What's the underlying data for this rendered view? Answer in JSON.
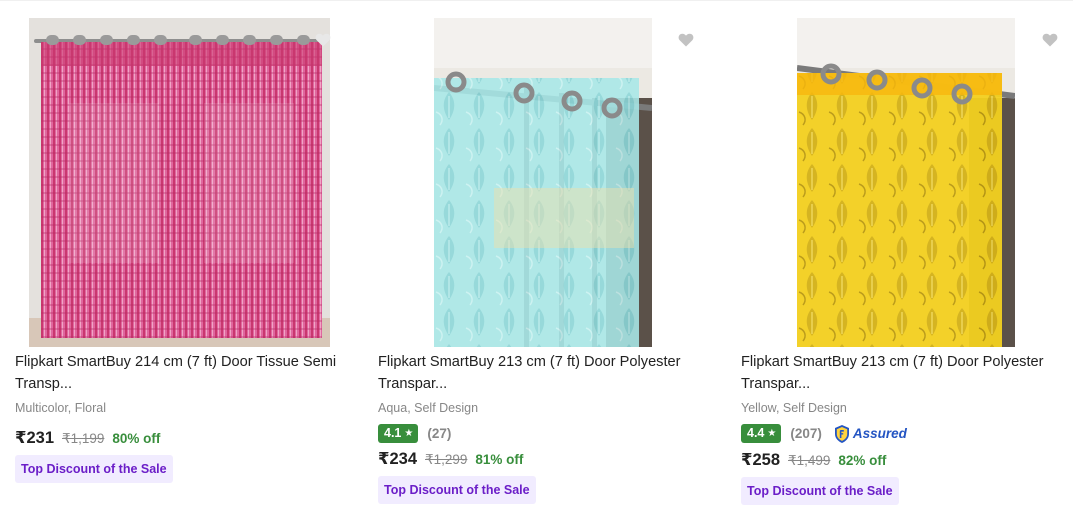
{
  "products": [
    {
      "title": "Flipkart SmartBuy 214 cm (7 ft) Door Tissue Semi",
      "title2": "Transp...",
      "variant": "Multicolor, Floral",
      "price": "₹231",
      "mrp": "₹1,199",
      "discount": "80% off",
      "tag": "Top Discount of the Sale",
      "image": "pink-striped-curtain",
      "color": "#d9579a"
    },
    {
      "title": "Flipkart SmartBuy 213 cm (7 ft) Door Polyester",
      "title2": "Transpar...",
      "variant": "Aqua, Self Design",
      "rating": "4.1",
      "reviews": "(27)",
      "price": "₹234",
      "mrp": "₹1,299",
      "discount": "81% off",
      "tag": "Top Discount of the Sale",
      "image": "aqua-leaf-curtain",
      "color": "#97e3e4"
    },
    {
      "title": "Flipkart SmartBuy 213 cm (7 ft) Door Polyester",
      "title2": "Transpar...",
      "variant": "Yellow, Self Design",
      "rating": "4.4",
      "reviews": "(207)",
      "assured": "Assured",
      "price": "₹258",
      "mrp": "₹1,499",
      "discount": "82% off",
      "tag": "Top Discount of the Sale",
      "image": "yellow-leaf-curtain",
      "color": "#f2cf1e"
    }
  ],
  "icons": {
    "wishlist": "heart-icon",
    "rating": "star-icon",
    "assured": "flipkart-assured-icon"
  },
  "colors": {
    "rating_green": "#388e3c",
    "discount_green": "#388e3c",
    "tag_bg": "#f1ecff",
    "tag_text": "#6b1ec8",
    "assured_blue": "#2455c3"
  }
}
